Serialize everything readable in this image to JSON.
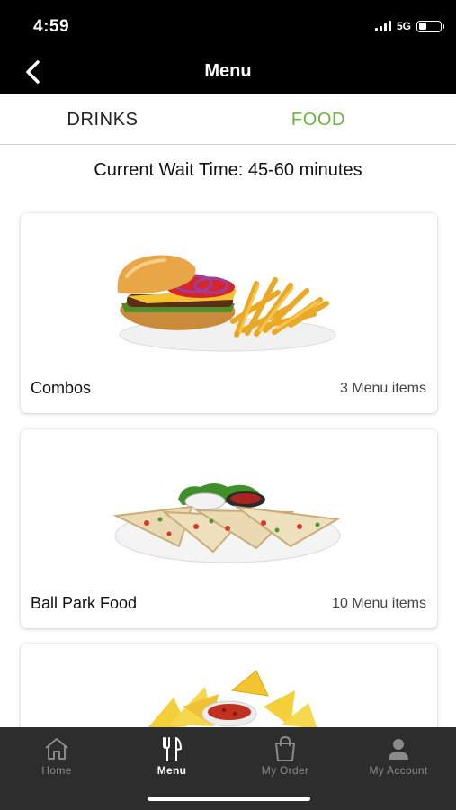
{
  "status_bar": {
    "time": "4:59",
    "network": "5G",
    "battery_level": 0.35
  },
  "header": {
    "title": "Menu",
    "back_icon": "chevron-left-icon"
  },
  "tabs": [
    {
      "label": "DRINKS",
      "active": false
    },
    {
      "label": "FOOD",
      "active": true
    }
  ],
  "wait_time": "Current Wait Time: 45-60 minutes",
  "categories": [
    {
      "name": "Combos",
      "count": "3 Menu items",
      "image": "burger-and-fries"
    },
    {
      "name": "Ball Park Food",
      "count": "10 Menu items",
      "image": "quesadilla-platter"
    },
    {
      "name": "",
      "count": "",
      "image": "nachos-with-salsa"
    }
  ],
  "bottom_nav": [
    {
      "label": "Home",
      "icon": "home-icon",
      "active": false
    },
    {
      "label": "Menu",
      "icon": "fork-knife-icon",
      "active": true
    },
    {
      "label": "My Order",
      "icon": "shopping-bag-icon",
      "active": false
    },
    {
      "label": "My Account",
      "icon": "person-icon",
      "active": false
    }
  ],
  "colors": {
    "accent": "#6cb33f",
    "header_bg": "#000000",
    "nav_bg": "#2d2d2d"
  }
}
